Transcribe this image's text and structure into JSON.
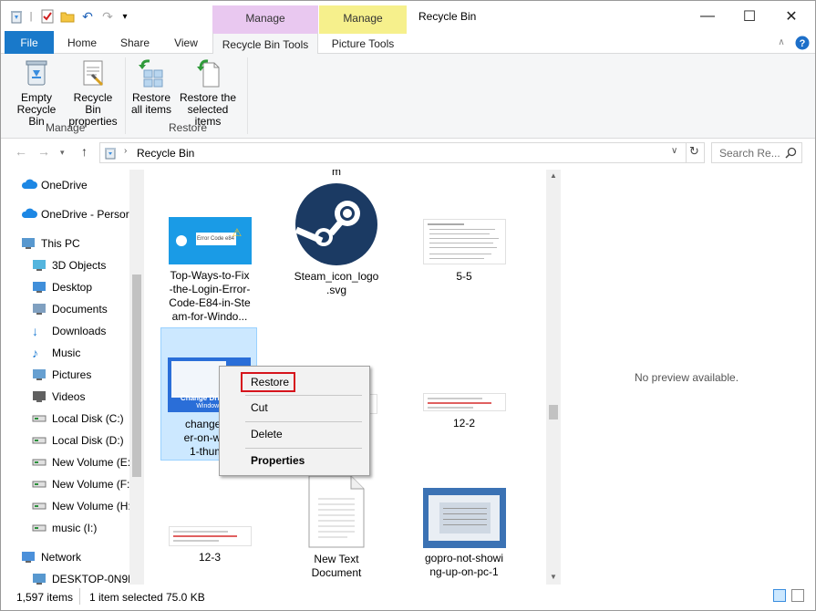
{
  "window": {
    "title": "Recycle Bin",
    "controls": {
      "minimize": "—",
      "maximize": "☐",
      "close": "✕"
    }
  },
  "context_tabs": {
    "manage_bin": "Manage",
    "manage_picture": "Manage"
  },
  "ribbon_tabs": [
    "File",
    "Home",
    "Share",
    "View",
    "Recycle Bin Tools",
    "Picture Tools"
  ],
  "ribbon": {
    "manage_group": {
      "label": "Manage",
      "empty_line1": "Empty",
      "empty_line2": "Recycle Bin",
      "props_line1": "Recycle Bin",
      "props_line2": "properties"
    },
    "restore_group": {
      "label": "Restore",
      "all_line1": "Restore",
      "all_line2": "all items",
      "sel_line1": "Restore the",
      "sel_line2": "selected items"
    }
  },
  "address": {
    "path": "Recycle Bin",
    "search_placeholder": "Search Re..."
  },
  "nav_items": [
    {
      "label": "OneDrive",
      "icon": "cloud-icon"
    },
    {
      "label": "OneDrive - Persor",
      "icon": "cloud-icon"
    },
    {
      "label": "This PC",
      "icon": "computer-icon"
    },
    {
      "label": "3D Objects",
      "icon": "cube-icon"
    },
    {
      "label": "Desktop",
      "icon": "desktop-icon"
    },
    {
      "label": "Documents",
      "icon": "documents-icon"
    },
    {
      "label": "Downloads",
      "icon": "download-icon"
    },
    {
      "label": "Music",
      "icon": "music-icon"
    },
    {
      "label": "Pictures",
      "icon": "pictures-icon"
    },
    {
      "label": "Videos",
      "icon": "videos-icon"
    },
    {
      "label": "Local Disk (C:)",
      "icon": "drive-icon"
    },
    {
      "label": "Local Disk (D:)",
      "icon": "drive-icon"
    },
    {
      "label": "New Volume (E:)",
      "icon": "drive-icon"
    },
    {
      "label": "New Volume (F:)",
      "icon": "drive-icon"
    },
    {
      "label": "New Volume (H:)",
      "icon": "drive-icon"
    },
    {
      "label": "music (I:)",
      "icon": "drive-icon"
    },
    {
      "label": "Network",
      "icon": "network-icon"
    },
    {
      "label": "DESKTOP-0N9D(",
      "icon": "computer-icon"
    }
  ],
  "files": {
    "partial_top": "m",
    "f1": [
      "Top-Ways-to-Fix",
      "-the-Login-Error-",
      "Code-E84-in-Ste",
      "am-for-Windo..."
    ],
    "f1_badge": "Error Code e84",
    "f2": [
      "Steam_icon_logo",
      ".svg"
    ],
    "f3": [
      "5-5"
    ],
    "f4": [
      "change-dr",
      "er-on-wind",
      "1-thumb"
    ],
    "f4_banner": "Change Drive Le",
    "f4_banner2": "Windows",
    "f6": [
      "12-2"
    ],
    "f7": [
      "12-3"
    ],
    "f8": [
      "New Text",
      "Document"
    ],
    "f9": [
      "gopro-not-showi",
      "ng-up-on-pc-1"
    ]
  },
  "preview_text": "No preview available.",
  "context_menu": {
    "restore": "Restore",
    "cut": "Cut",
    "delete": "Delete",
    "properties": "Properties"
  },
  "status": {
    "count": "1,597 items",
    "selected": "1 item selected",
    "size": "75.0 KB"
  },
  "colors": {
    "file_tab": "#1979ca",
    "manage_ctx": "#e9c8f0",
    "picture_ctx": "#f6f08c",
    "selection": "#cce8ff",
    "highlight_box": "#d6141c"
  }
}
